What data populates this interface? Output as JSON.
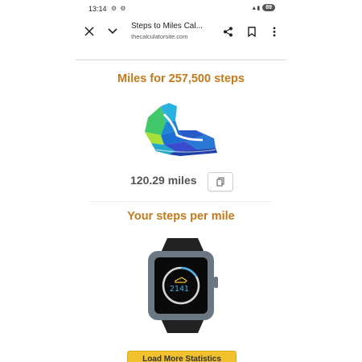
{
  "status_bar": {
    "time": "13:14",
    "left_icons": "⚙ ⚙",
    "right_icons": "▲▮",
    "battery": "89"
  },
  "toolbar": {
    "title": "Steps to Miles Cal...",
    "url": "thecalculatorsite.com",
    "icons": [
      "close-icon",
      "chevron-down-icon",
      "share-icon",
      "bookmark-icon",
      "more-vert-icon"
    ]
  },
  "main": {
    "heading1": "Miles for 257,500 steps",
    "result": "120.29 miles",
    "heading2": "Your steps per mile",
    "steps_per_mile": "2141",
    "load_button": "Load More Statistics"
  },
  "colors": {
    "heading": "#c47a1a",
    "result_text": "#555555",
    "button": "#f2c12e",
    "watch_digits": "#4ab0e6"
  }
}
